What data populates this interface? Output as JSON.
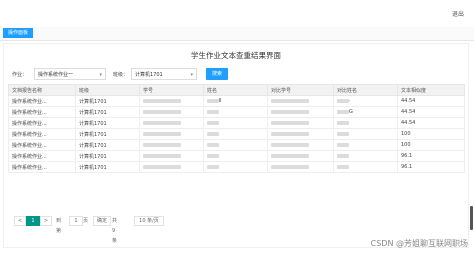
{
  "header": {
    "user_link": "退出"
  },
  "tabs": [
    {
      "label": "操作面板"
    }
  ],
  "page": {
    "title": "学生作业文本查重结果界面"
  },
  "filters": {
    "homework_label": "作业：",
    "homework_value": "操作系统作业一",
    "class_label": "班级：",
    "class_value": "计算机1701",
    "search_button": "搜索"
  },
  "table": {
    "headers": [
      "文档报告名称",
      "班级",
      "学号",
      "姓名",
      "对比学号",
      "对比姓名",
      "文本相似度"
    ],
    "rows": [
      {
        "name": "操作系统作业...",
        "class": "计算机1701",
        "name_suffix": "Ⅱ",
        "cmp_name_suffix": "·",
        "similarity": "44.54"
      },
      {
        "name": "操作系统作业...",
        "class": "计算机1701",
        "name_suffix": "",
        "cmp_name_suffix": "G",
        "similarity": "44.54"
      },
      {
        "name": "操作系统作业...",
        "class": "计算机1701",
        "name_suffix": "",
        "cmp_name_suffix": "",
        "similarity": "44.54"
      },
      {
        "name": "操作系统作业...",
        "class": "计算机1701",
        "name_suffix": "",
        "cmp_name_suffix": "",
        "similarity": "100"
      },
      {
        "name": "操作系统作业...",
        "class": "计算机1701",
        "name_suffix": "",
        "cmp_name_suffix": "",
        "similarity": "100"
      },
      {
        "name": "操作系统作业...",
        "class": "计算机1701",
        "name_suffix": "",
        "cmp_name_suffix": "",
        "similarity": "96.1"
      },
      {
        "name": "操作系统作业...",
        "class": "计算机1701",
        "name_suffix": "",
        "cmp_name_suffix": "",
        "similarity": "96.1"
      }
    ]
  },
  "pager": {
    "prev": "<",
    "current": "1",
    "next": ">",
    "goto_label": "到第",
    "goto_value": "1",
    "page_unit": "页",
    "confirm": "确定",
    "total": "共 9 条",
    "page_size": "10 条/页"
  },
  "watermark": "CSDN @芳姐聊互联网职场"
}
